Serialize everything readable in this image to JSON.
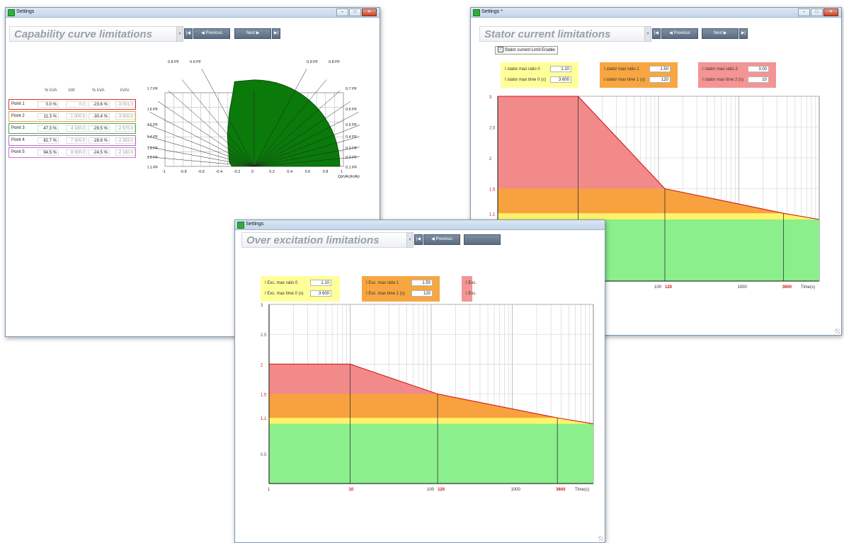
{
  "win1": {
    "title": "Settings",
    "heading": "Capability curve limitations",
    "prev_label": "Previous",
    "next_label": "Next",
    "table": {
      "headers": [
        "% kVA",
        "kW",
        "% kVA",
        "kVAr"
      ],
      "rows": [
        {
          "name": "Point 1",
          "v1": "0.0 %",
          "v2": "0.0",
          "v3": "-23.6 %",
          "v4": "-3 091.0",
          "color": "#e03030"
        },
        {
          "name": "Point 2",
          "v1": "11.3 %",
          "v2": "1 000.0",
          "v3": "-30.4 %",
          "v4": "-3 000.0",
          "color": "#f0a040"
        },
        {
          "name": "Point 3",
          "v1": "47.3 %",
          "v2": "4 180.0",
          "v3": "-29.5 %",
          "v4": "-2 570.0",
          "color": "#40b040"
        },
        {
          "name": "Point 4",
          "v1": "82.7 %",
          "v2": "7 300.0",
          "v3": "-28.6 %",
          "v4": "-2 353.0",
          "color": "#b070c0"
        },
        {
          "name": "Point 5",
          "v1": "94.5 %",
          "v2": "8 000.0",
          "v3": "-24.5 %",
          "v4": "-2 180.0",
          "color": "#d070d0"
        }
      ]
    },
    "chart": {
      "pf_top_left": [
        "0.8 PF",
        "0.9 PF"
      ],
      "pf_top_right": [
        "0.9 PF",
        "0.8 PF"
      ],
      "pf_left": [
        "0.7 PF",
        "0.6 PF",
        "0.5 PF",
        "0.4 PF",
        "0.3 PF",
        "0.2 PF",
        "0.1 PF"
      ],
      "pf_right": [
        "0.7 PF",
        "0.6 PF",
        "0.5 PF",
        "0.4 PF",
        "0.3 PF",
        "0.2 PF",
        "0.1 PF"
      ],
      "x_ticks": [
        "-1",
        "-0.8",
        "-0.6",
        "-0.4",
        "-0.2",
        "0",
        "0.2",
        "0.4",
        "0.6",
        "0.8",
        "1"
      ],
      "x_label": "Q(kVAr)/kVA(n)",
      "fill_color": "#0a7a0a"
    }
  },
  "win2": {
    "title": "Settings *",
    "heading": "Stator current limitations",
    "prev_label": "Previous",
    "next_label": "Next",
    "checkbox_label": "Stator current Limit Enable",
    "checkbox_checked": true,
    "panels": [
      {
        "label_a": "I stator max ratio 0",
        "value_a": "1.10",
        "label_b": "I stator max time 0 (s)",
        "value_b": "3 600",
        "color": "#ffff9a"
      },
      {
        "label_a": "I stator max ratio 1",
        "value_a": "1.50",
        "label_b": "I stator max time 1 (s)",
        "value_b": "120",
        "color": "#f7a641"
      },
      {
        "label_a": "I stator max ratio 2",
        "value_a": "3.00",
        "label_b": "I stator max time 2 (s)",
        "value_b": "10",
        "color": "#f49494"
      }
    ],
    "chart": {
      "y_ticks": [
        "3",
        "2.5",
        "2",
        "1.5",
        "1,1",
        "0.5"
      ],
      "x_ticks": [
        "1",
        "10",
        "100",
        "120",
        "1000",
        "3600"
      ],
      "x_label": "Time(s)"
    }
  },
  "win3": {
    "title": "Settings",
    "heading": "Over excitation limitations",
    "prev_label": "Previous",
    "panels": [
      {
        "label_a": "I Exc. max ratio 0",
        "value_a": "1.10",
        "label_b": "I Exc. max time 0 (s)",
        "value_b": "3 600",
        "color": "#ffff9a"
      },
      {
        "label_a": "I Exc. max ratio 1",
        "value_a": "1.50",
        "label_b": "I Exc. max time 1 (s)",
        "value_b": "120",
        "color": "#f7a641"
      },
      {
        "label_a": "I Exc.",
        "value_a": "",
        "label_b": "I Exc.",
        "value_b": "",
        "color": "#f49494"
      }
    ],
    "chart": {
      "y_ticks": [
        "3",
        "2.5",
        "2",
        "1.5",
        "1,1",
        "0.5"
      ],
      "x_ticks": [
        "1",
        "10",
        "100",
        "120",
        "1000",
        "3600"
      ],
      "x_label": "Time(s)"
    }
  },
  "chart_data": [
    {
      "type": "area",
      "title": "",
      "xlabel": "Time(s)",
      "ylabel": "",
      "x_scale": "log",
      "xlim": [
        1,
        10000
      ],
      "ylim": [
        0,
        3
      ],
      "x": [
        1,
        10,
        120,
        3600,
        10000
      ],
      "series": [
        {
          "name": "",
          "values": [
            3.0,
            3.0,
            1.5,
            1.1,
            1.0
          ]
        }
      ],
      "bands": [
        1.1,
        1.5,
        3.0
      ]
    },
    {
      "type": "area",
      "title": "",
      "xlabel": "Time(s)",
      "ylabel": "",
      "x_scale": "log",
      "xlim": [
        1,
        10000
      ],
      "ylim": [
        0,
        3
      ],
      "x": [
        1,
        10,
        120,
        3600,
        10000
      ],
      "series": [
        {
          "name": "",
          "values": [
            2.0,
            2.0,
            1.5,
            1.1,
            1.0
          ]
        }
      ],
      "bands": [
        1.1,
        1.5,
        2.0
      ]
    }
  ]
}
